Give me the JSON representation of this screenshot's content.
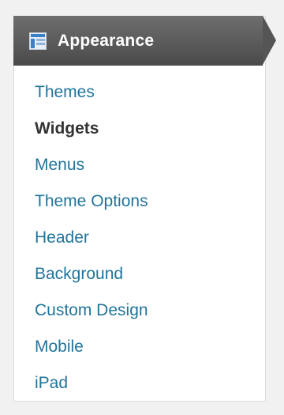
{
  "section": {
    "title": "Appearance",
    "icon": "appearance-window-icon"
  },
  "colors": {
    "link": "#21759b",
    "current": "#333333",
    "header_bg": "#555555",
    "icon_blue": "#3a80c8"
  },
  "menu": {
    "items": [
      {
        "label": "Themes",
        "current": false
      },
      {
        "label": "Widgets",
        "current": true
      },
      {
        "label": "Menus",
        "current": false
      },
      {
        "label": "Theme Options",
        "current": false
      },
      {
        "label": "Header",
        "current": false
      },
      {
        "label": "Background",
        "current": false
      },
      {
        "label": "Custom Design",
        "current": false
      },
      {
        "label": "Mobile",
        "current": false
      },
      {
        "label": "iPad",
        "current": false
      }
    ]
  }
}
